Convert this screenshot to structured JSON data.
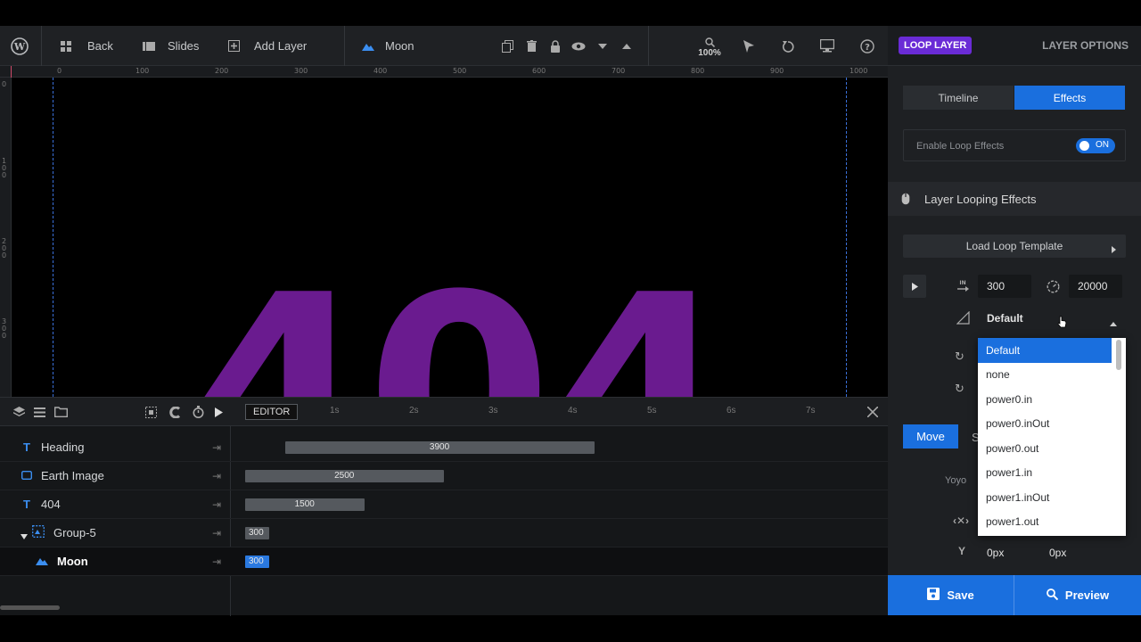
{
  "toolbar": {
    "back_label": "Back",
    "slides_label": "Slides",
    "add_layer_label": "Add Layer",
    "current_layer": "Moon",
    "zoom": "100%"
  },
  "ruler": {
    "h_labels": [
      "0",
      "100",
      "200",
      "300",
      "400",
      "500",
      "600",
      "700",
      "800",
      "900",
      "1000"
    ],
    "v_labels": [
      "0",
      "100",
      "200",
      "300"
    ]
  },
  "canvas": {
    "big_text": "404",
    "text_color": "#6a1b8f"
  },
  "timeline": {
    "editor_label": "EDITOR",
    "ticks": [
      "1s",
      "2s",
      "3s",
      "4s",
      "5s",
      "6s",
      "7s"
    ],
    "layers": [
      {
        "type": "text",
        "name": "Heading",
        "duration": "3900",
        "start_s": 0.5,
        "dur_s": 3.9
      },
      {
        "type": "image",
        "name": "Earth Image",
        "duration": "2500",
        "start_s": 0.0,
        "dur_s": 2.5
      },
      {
        "type": "text",
        "name": "404",
        "duration": "1500",
        "start_s": 0.0,
        "dur_s": 1.5
      },
      {
        "type": "group",
        "name": "Group-5",
        "duration": "300",
        "start_s": 0.0,
        "dur_s": 0.3
      },
      {
        "type": "shape",
        "name": "Moon",
        "duration": "300",
        "start_s": 0.0,
        "dur_s": 0.3
      }
    ]
  },
  "panel": {
    "badge": "LOOP LAYER",
    "options_label": "LAYER OPTIONS",
    "tabs": [
      "Timeline",
      "Effects"
    ],
    "enable_label": "Enable Loop Effects",
    "toggle_label": "ON",
    "section_title": "Layer Looping Effects",
    "load_template": "Load Loop Template",
    "in_value": "300",
    "speed_value": "20000",
    "easing_selected": "Default",
    "easing_options": [
      "Default",
      "none",
      "power0.in",
      "power0.inOut",
      "power0.out",
      "power1.in",
      "power1.inOut",
      "power1.out"
    ],
    "move_label": "Move",
    "move_partial": "S",
    "yoyo_label": "Yoyo",
    "y_value_1": "0px",
    "y_value_2": "0px",
    "save_label": "Save",
    "preview_label": "Preview"
  },
  "colors": {
    "accent": "#1a6fde",
    "badge": "#6a2bd6",
    "guide": "#3a6fd8"
  }
}
